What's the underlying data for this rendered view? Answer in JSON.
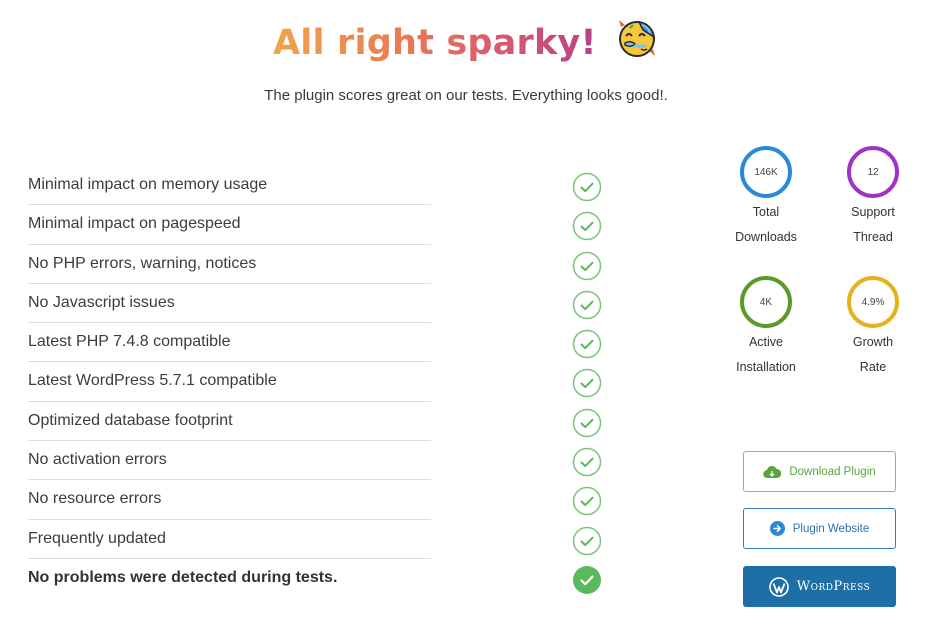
{
  "header": {
    "title": "All right sparky!",
    "emoji": "partying-face-emoji",
    "subtitle": "The plugin scores great on our tests. Everything looks good!."
  },
  "checks": [
    {
      "label": "Minimal impact on memory usage",
      "status": "passed"
    },
    {
      "label": "Minimal impact on pagespeed",
      "status": "passed"
    },
    {
      "label": "No PHP errors, warning, notices",
      "status": "passed"
    },
    {
      "label": "No Javascript issues",
      "status": "passed"
    },
    {
      "label": "Latest PHP 7.4.8 compatible",
      "status": "passed"
    },
    {
      "label": "Latest WordPress 5.7.1 compatible",
      "status": "passed"
    },
    {
      "label": "Optimized database footprint",
      "status": "passed"
    },
    {
      "label": "No activation errors",
      "status": "passed"
    },
    {
      "label": "No resource errors",
      "status": "passed"
    },
    {
      "label": "Frequently updated",
      "status": "passed"
    }
  ],
  "summary": {
    "label": "No problems were detected during tests.",
    "status": "all-passed"
  },
  "stats": [
    {
      "value": "146K",
      "caption_line1": "Total",
      "caption_line2": "Downloads",
      "color": "#2a8ad8"
    },
    {
      "value": "12",
      "caption_line1": "Support",
      "caption_line2": "Thread",
      "color": "#a133c4"
    },
    {
      "value": "4K",
      "caption_line1": "Active",
      "caption_line2": "Installation",
      "color": "#5a9a2a"
    },
    {
      "value": "4.9%",
      "caption_line1": "Growth",
      "caption_line2": "Rate",
      "color": "#e3b21c"
    }
  ],
  "buttons": {
    "download": {
      "label": "Download Plugin",
      "icon": "cloud-download-icon"
    },
    "website": {
      "label": "Plugin Website",
      "icon": "arrow-right-circle-icon"
    },
    "wordpress": {
      "label": "WordPress",
      "icon": "wordpress-logo-icon"
    }
  },
  "colors": {
    "check_green": "#5cb85c",
    "download_green": "#5aa43c",
    "website_blue": "#2a72b5",
    "wordpress_blue": "#1d6fa5"
  }
}
